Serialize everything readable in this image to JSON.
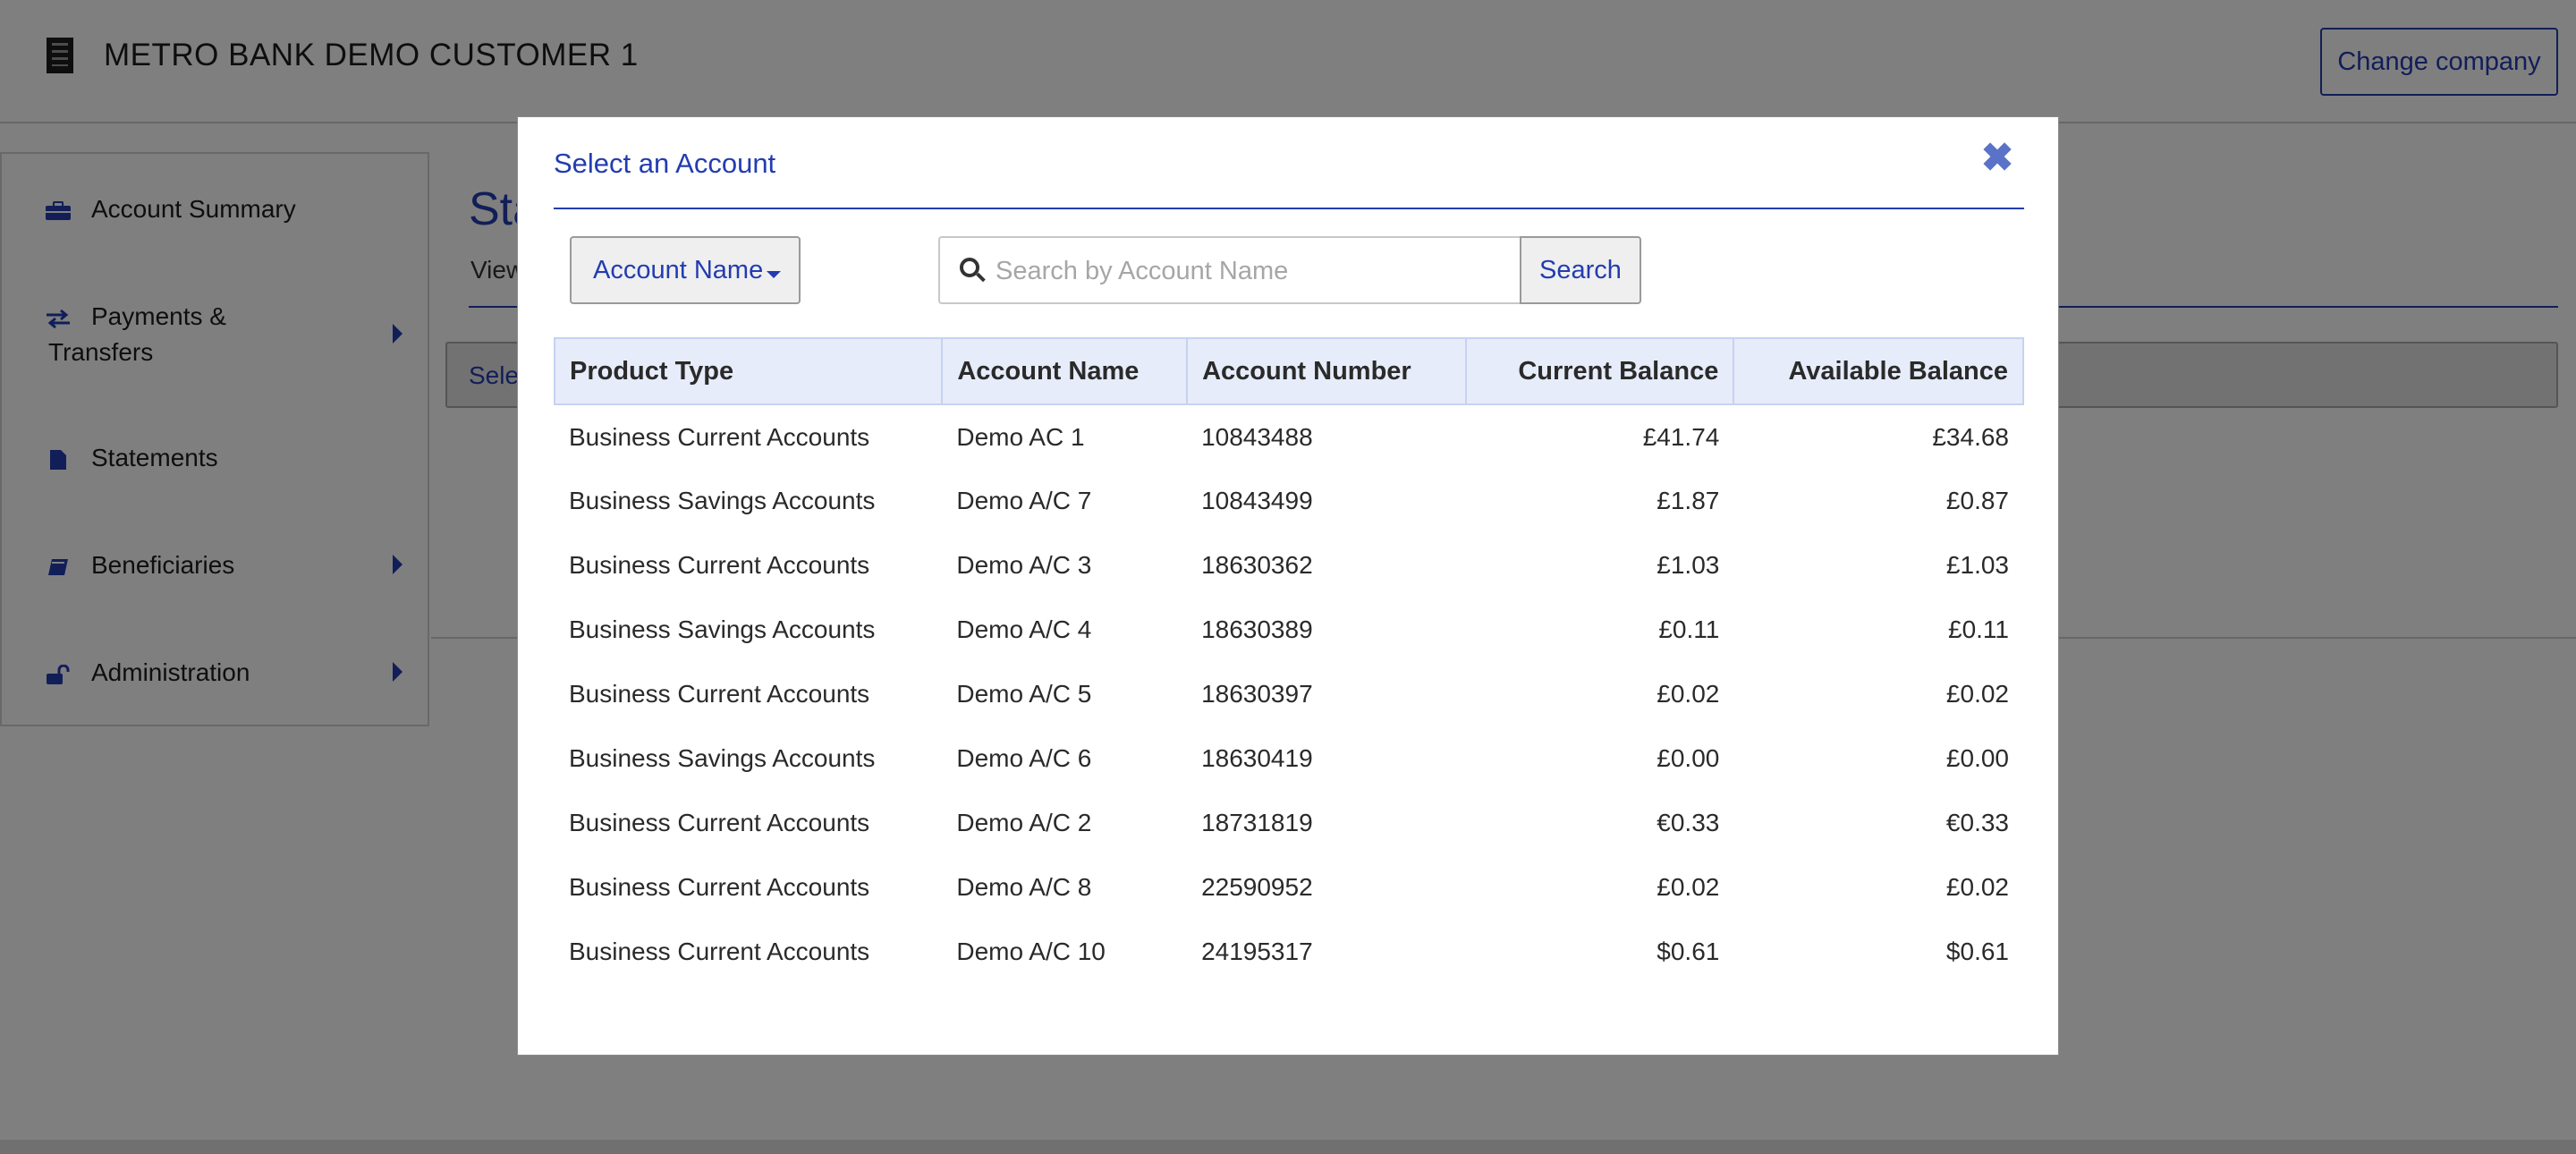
{
  "header": {
    "company_name": "METRO BANK DEMO CUSTOMER 1",
    "company_icon": "building-icon",
    "change_company_label": "Change company"
  },
  "sidebar": {
    "items": [
      {
        "label": "Account Summary",
        "icon": "briefcase-icon",
        "has_submenu": false
      },
      {
        "label": "Payments & Transfers",
        "icon": "transfer-arrows-icon",
        "has_submenu": true
      },
      {
        "label": "Statements",
        "icon": "document-icon",
        "has_submenu": false
      },
      {
        "label": "Beneficiaries",
        "icon": "book-icon",
        "has_submenu": true
      },
      {
        "label": "Administration",
        "icon": "unlock-icon",
        "has_submenu": true
      }
    ]
  },
  "main": {
    "title_fragment": "Sta",
    "subtitle_fragment": "View",
    "select_fragment": "Sele"
  },
  "modal": {
    "title": "Select an Account",
    "close_icon": "close-icon",
    "filter_label": "Account Name",
    "search_placeholder": "Search by Account Name",
    "search_value": "",
    "search_button": "Search",
    "columns": [
      "Product Type",
      "Account Name",
      "Account Number",
      "Current Balance",
      "Available Balance"
    ],
    "rows": [
      {
        "product_type": "Business Current Accounts",
        "account_name": "Demo AC 1",
        "account_number": "10843488",
        "current_balance": "£41.74",
        "available_balance": "£34.68"
      },
      {
        "product_type": "Business Savings Accounts",
        "account_name": "Demo A/C 7",
        "account_number": "10843499",
        "current_balance": "£1.87",
        "available_balance": "£0.87"
      },
      {
        "product_type": "Business Current Accounts",
        "account_name": "Demo A/C 3",
        "account_number": "18630362",
        "current_balance": "£1.03",
        "available_balance": "£1.03"
      },
      {
        "product_type": "Business Savings Accounts",
        "account_name": "Demo A/C 4",
        "account_number": "18630389",
        "current_balance": "£0.11",
        "available_balance": "£0.11"
      },
      {
        "product_type": "Business Current Accounts",
        "account_name": "Demo A/C 5",
        "account_number": "18630397",
        "current_balance": "£0.02",
        "available_balance": "£0.02"
      },
      {
        "product_type": "Business Savings Accounts",
        "account_name": "Demo A/C 6",
        "account_number": "18630419",
        "current_balance": "£0.00",
        "available_balance": "£0.00"
      },
      {
        "product_type": "Business Current Accounts",
        "account_name": "Demo A/C 2",
        "account_number": "18731819",
        "current_balance": "€0.33",
        "available_balance": "€0.33"
      },
      {
        "product_type": "Business Current Accounts",
        "account_name": "Demo A/C 8",
        "account_number": "22590952",
        "current_balance": "£0.02",
        "available_balance": "£0.02"
      },
      {
        "product_type": "Business Current Accounts",
        "account_name": "Demo A/C 10",
        "account_number": "24195317",
        "current_balance": "$0.61",
        "available_balance": "$0.61"
      }
    ]
  },
  "colors": {
    "accent": "#233cb0",
    "header_row_bg": "#e6ecfa",
    "overlay": "rgba(0,0,0,0.5)"
  }
}
